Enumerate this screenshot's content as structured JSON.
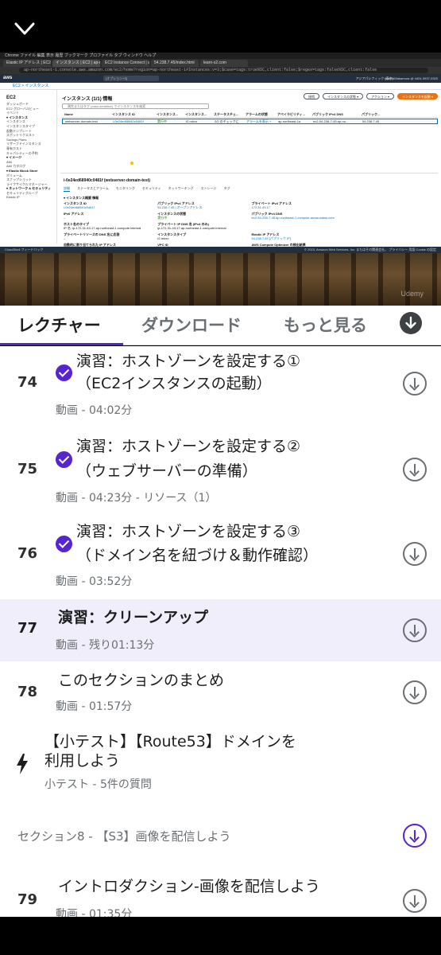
{
  "browser": {
    "menubar": "Chrome  ファイル  編集  表示  履歴  ブックマーク  プロファイル  タブ  ウィンドウ  ヘルプ",
    "tabs": [
      "Elastic IP アドレス | EC2 | ap-...",
      "インスタンス | EC2 | ap-north...",
      "EC2 Instance Connect | ap-nor...",
      "54.238.7.45/index.html",
      "learn-s2.com"
    ],
    "url": "ap-northeast-1.console.aws.amazon.com/ec2/home?region=ap-northeast-1#Instances:v=3;$case=tags:true%5C,client:false;$regex=tags:false%5C,client:false"
  },
  "aws": {
    "logo": "aws",
    "search": "[オプション+S]",
    "region": "アジアパシフィック (東京)",
    "account": "learn460akamura @ 4424-3937-0320",
    "breadcrumb": "EC2 > インスタンス",
    "sidebar": {
      "title": "EC2",
      "items": [
        "ダッシュボード",
        "EC2 グローバルビュー",
        "イベント"
      ],
      "groups": [
        {
          "name": "▾ インスタンス",
          "items": [
            "インスタンス",
            "インスタンスタイプ",
            "起動テンプレート",
            "スポットリクエスト",
            "Savings Plans",
            "リザーブドインスタンス",
            "専有ホスト",
            "キャパシティーの予約"
          ]
        },
        {
          "name": "▾ イメージ",
          "items": [
            "AMI",
            "AMI カタログ"
          ]
        },
        {
          "name": "▾ Elastic Block Store",
          "items": [
            "ボリューム",
            "スナップショット",
            "ライフサイクルマネージャー"
          ]
        },
        {
          "name": "▾ ネットワーク & セキュリティ",
          "items": [
            "セキュリティグループ",
            "Elastic IP"
          ]
        }
      ]
    },
    "main": {
      "title": "インスタンス (1/1) 情報",
      "buttons": [
        "接続",
        "インスタンスの状態 ▾",
        "アクション ▾",
        "インスタンスを起動 ▾"
      ],
      "filter": "属性またはタグ (case-sensitive) でインスタンスを検索",
      "columns": [
        "Name",
        "インスタンス ID",
        "インスタンス...",
        "インスタンス...",
        "ステータスチェ...",
        "アラームの状態",
        "アベイラビリティ...",
        "パブリック IPv4 DNS",
        "パブリック..."
      ],
      "row": [
        "webserver-domain-test",
        "i-0e24ed68940c0481f",
        "実行中",
        "t2.micro",
        "2/2 のチェックに",
        "アラームを表示 +",
        "ap-northeast-1a",
        "ec2-54-238-7-45.ap-no...",
        "54.238.7.45"
      ]
    },
    "detail": {
      "title": "i-0e24ed68940c0481f (webserver-domain-test)",
      "tabs": [
        "詳細",
        "ステータスとアラーム",
        "モニタリング",
        "セキュリティ",
        "ネットワーキング",
        "ストレージ",
        "タグ"
      ],
      "summary": "▾ インスタンス概要 情報",
      "fields": [
        {
          "label": "インスタンス ID",
          "value": "i-0e24ed68940c0481f"
        },
        {
          "label": "パブリック IPv4 アドレス",
          "value": "54.238.7.45 | オープンアドレス"
        },
        {
          "label": "プライベート IPv4 アドレス",
          "value": "172.31.43.17"
        },
        {
          "label": "",
          "value": ""
        },
        {
          "label": "IPv6 アドレス",
          "value": "–"
        },
        {
          "label": "インスタンスの状態",
          "value": "実行中"
        },
        {
          "label": "パブリック IPv4 DNS",
          "value": "ec2-54-238-7-45.ap-northeast-1.compute.amazonaws.com"
        },
        {
          "label": "",
          "value": ""
        },
        {
          "label": "ホスト名のタイプ",
          "value": "IP 名: ip-172-31-43-17.ap-northeast-1.compute.internal"
        },
        {
          "label": "プライベート IP DNS 名 (IPv4 のみ)",
          "value": "ip-172-31-43-17.ap-northeast-1.compute.internal"
        },
        {
          "label": "",
          "value": ""
        },
        {
          "label": "",
          "value": ""
        },
        {
          "label": "プライベートリソースの DNS 名に応答",
          "value": "–"
        },
        {
          "label": "インスタンスタイプ",
          "value": "t2.micro"
        },
        {
          "label": "Elastic IP アドレス",
          "value": "54.238.7.45 [パブリック IP]"
        },
        {
          "label": "",
          "value": ""
        },
        {
          "label": "自動的に割り当てられた IP アドレス",
          "value": "–"
        },
        {
          "label": "VPC ID",
          "value": "vpc-0e5f0d70d3d7b709f"
        },
        {
          "label": "AWS Compute Optimizer の検出結果",
          "value": "レコメンデーションについては、AWS Compute Optimizer にオプトインしてください。"
        },
        {
          "label": "",
          "value": ""
        }
      ]
    },
    "footer": "CloudShell  フィードバック",
    "footer_right": "© 2023, Amazon Web Services, Inc. またはその関連会社。  プライバシー  用語  Cookie の設定"
  },
  "watermark": "Udemy",
  "tabs": {
    "lectures": "レクチャー",
    "downloads": "ダウンロード",
    "more": "もっと見る"
  },
  "lectures": [
    {
      "num": "74",
      "title1": "演習：ホストゾーンを設定する①",
      "title2": "（EC2インスタンスの起動）",
      "meta": "動画 - 04:02分",
      "done": true
    },
    {
      "num": "75",
      "title1": "演習：ホストゾーンを設定する②",
      "title2": "（ウェブサーバーの準備）",
      "meta": "動画 - 04:23分 - リソース（1）",
      "done": true
    },
    {
      "num": "76",
      "title1": "演習：ホストゾーンを設定する③",
      "title2": "（ドメイン名を紐づけ＆動作確認）",
      "meta": "動画 - 03:52分",
      "done": true
    },
    {
      "num": "77",
      "title1": "演習：クリーンアップ",
      "meta": "動画 - 残り01:13分",
      "current": true
    },
    {
      "num": "78",
      "title1": "このセクションのまとめ",
      "meta": "動画 - 01:57分"
    },
    {
      "title1": "【小テスト】【Route53】ドメインを",
      "title2": "利用しよう",
      "meta": "小テスト - 5件の質問",
      "quiz": true
    },
    {
      "num": "79",
      "title1": "イントロダクション-画像を配信しよう",
      "meta": "動画 - 01:35分"
    }
  ],
  "section": "セクション8 - 【S3】画像を配信しよう",
  "colors": {
    "accent": "#5624d0",
    "current_bg": "#f1eefb",
    "text": "#1c1d1f",
    "muted": "#6a6f73"
  }
}
